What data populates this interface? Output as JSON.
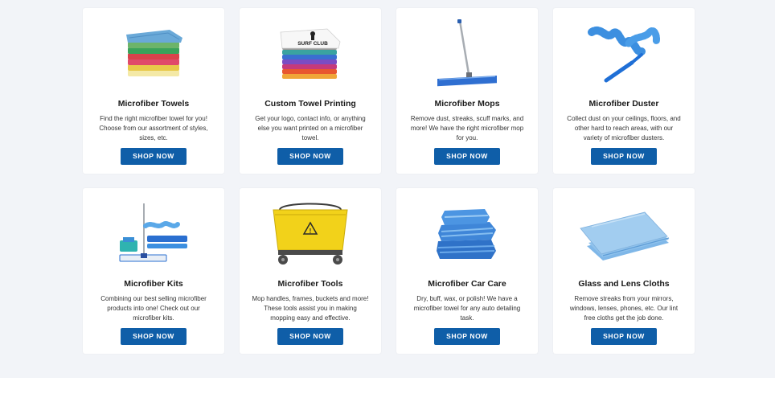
{
  "products": [
    {
      "title": "Microfiber Towels",
      "description": "Find the right microfiber towel for you! Choose from our assortment of styles, sizes, etc.",
      "button": "SHOP NOW",
      "image_icon": "stacked-towels-icon"
    },
    {
      "title": "Custom Towel Printing",
      "description": "Get your logo, contact info, or anything else you want printed on a microfiber towel.",
      "button": "SHOP NOW",
      "image_icon": "printed-towels-icon",
      "image_text": "SURF CLUB"
    },
    {
      "title": "Microfiber Mops",
      "description": "Remove dust, streaks, scuff marks, and more! We have the right microfiber mop for you.",
      "button": "SHOP NOW",
      "image_icon": "flat-mop-icon"
    },
    {
      "title": "Microfiber Duster",
      "description": "Collect dust on your ceilings, floors, and other hard to reach areas, with our variety of microfiber dusters.",
      "button": "SHOP NOW",
      "image_icon": "duster-icon"
    },
    {
      "title": "Microfiber Kits",
      "description": "Combining our best selling microfiber products into one! Check out our microfiber kits.",
      "button": "SHOP NOW",
      "image_icon": "mop-kit-icon"
    },
    {
      "title": "Microfiber Tools",
      "description": "Mop handles, frames, buckets and more! These tools assist you in making mopping easy and effective.",
      "button": "SHOP NOW",
      "image_icon": "mop-bucket-icon"
    },
    {
      "title": "Microfiber Car Care",
      "description": "Dry, buff, wax, or polish! We have a microfiber towel for any auto detailing task.",
      "button": "SHOP NOW",
      "image_icon": "car-care-towels-icon"
    },
    {
      "title": "Glass and Lens Cloths",
      "description": "Remove streaks from your mirrors, windows, lenses, phones, etc. Our lint free cloths get the job done.",
      "button": "SHOP NOW",
      "image_icon": "glass-cloths-icon"
    }
  ],
  "colors": {
    "button": "#0f5ea8",
    "background": "#f2f4f8",
    "card": "#ffffff"
  }
}
